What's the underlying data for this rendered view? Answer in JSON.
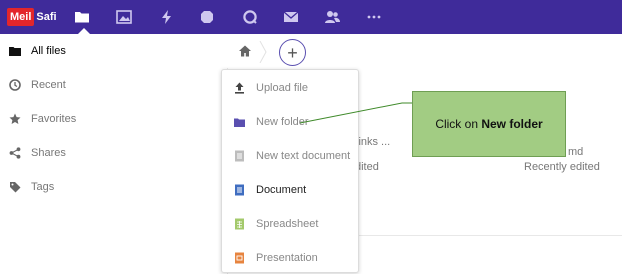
{
  "brand": {
    "badge": "Meil",
    "text": "Safi"
  },
  "colors": {
    "topbar": "#3f2b9a",
    "accent": "#5a4fb0",
    "callout": "#a2cc83",
    "brand_red": "#e3262b"
  },
  "topnav": {
    "apps": [
      "files-icon",
      "photos-icon",
      "activity-icon",
      "notes-icon",
      "talk-icon",
      "mail-icon",
      "contacts-icon",
      "more-icon"
    ]
  },
  "sidebar": {
    "items": [
      {
        "label": "All files",
        "icon": "folder-icon",
        "active": true
      },
      {
        "label": "Recent",
        "icon": "clock-icon"
      },
      {
        "label": "Favorites",
        "icon": "star-icon"
      },
      {
        "label": "Shares",
        "icon": "share-icon"
      },
      {
        "label": "Tags",
        "icon": "tag-icon"
      }
    ]
  },
  "content": {
    "add_button": "+",
    "partial_text_1": "links ...",
    "partial_text_2": "dited",
    "partial_text_3": "md",
    "partial_text_4": "Recently edited"
  },
  "menu": {
    "items": [
      {
        "label": "Upload file",
        "icon": "upload-icon"
      },
      {
        "label": "New folder",
        "icon": "folder-icon"
      },
      {
        "label": "New text document",
        "icon": "text-document-icon"
      },
      {
        "label": "Document",
        "icon": "document-icon"
      },
      {
        "label": "Spreadsheet",
        "icon": "spreadsheet-icon"
      },
      {
        "label": "Presentation",
        "icon": "presentation-icon"
      }
    ]
  },
  "callout": {
    "prefix": "Click on ",
    "bold": "New folder"
  }
}
